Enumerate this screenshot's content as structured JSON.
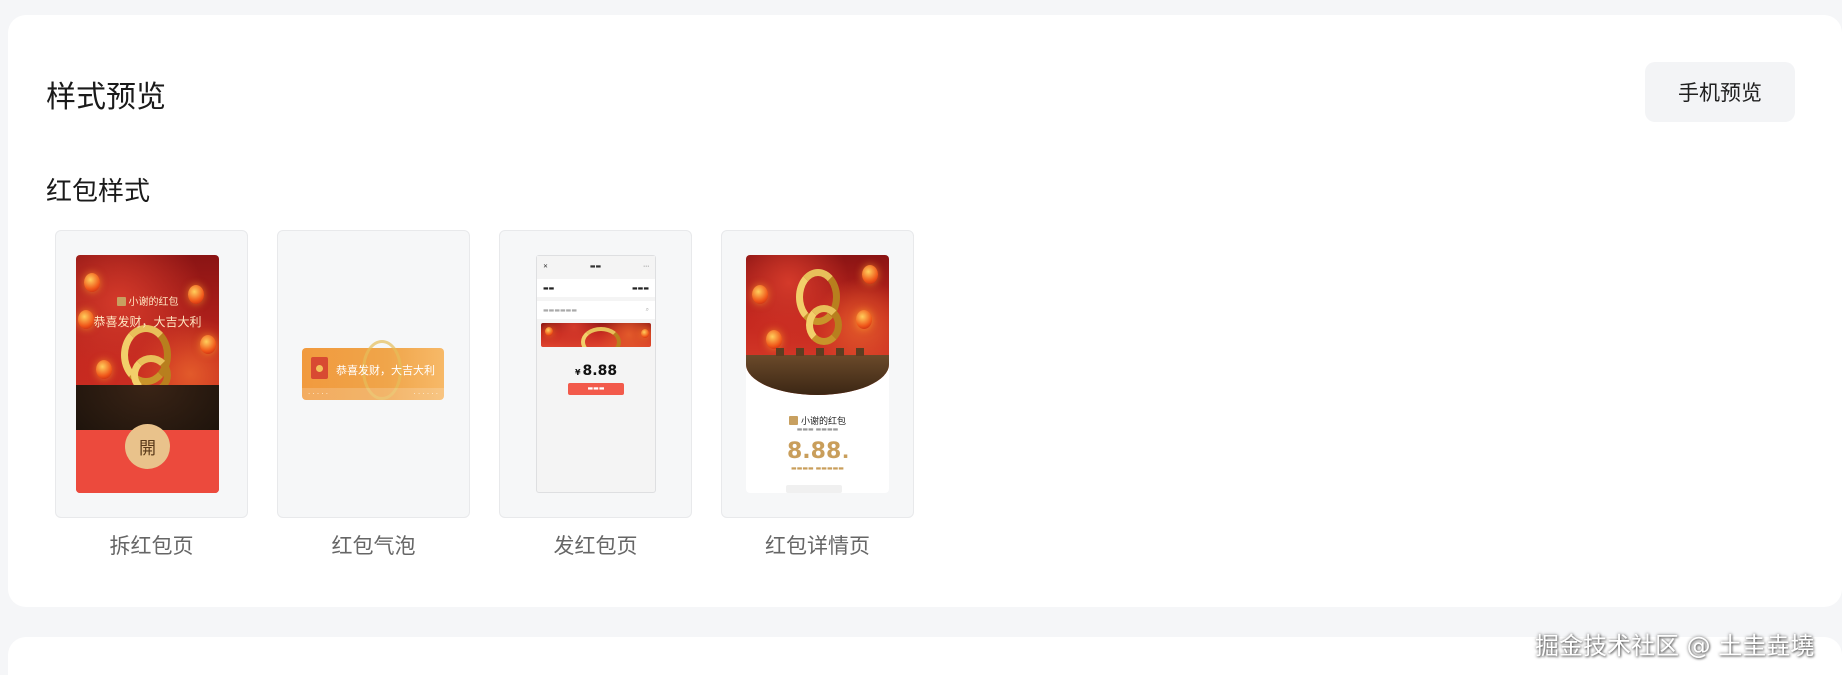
{
  "header": {
    "title": "样式预览",
    "preview_button": "手机预览"
  },
  "section": {
    "title": "红包样式"
  },
  "styles": [
    {
      "label": "拆红包页",
      "sender": "小谢的红包",
      "wish": "恭喜发财，大吉大利",
      "open_text": "開"
    },
    {
      "label": "红包气泡",
      "wish": "恭喜发财，大吉大利"
    },
    {
      "label": "发红包页",
      "amount_symbol": "¥",
      "amount": "8.88"
    },
    {
      "label": "红包详情页",
      "sender": "小谢的红包",
      "amount": "8.88"
    }
  ],
  "watermark": "掘金技术社区 @ 土圭垚墝",
  "colors": {
    "page_bg": "#f5f6f8",
    "card_bg": "#ffffff",
    "festive_red": "#c3261e",
    "gold": "#c99e5b",
    "send_button": "#f25a4b"
  }
}
